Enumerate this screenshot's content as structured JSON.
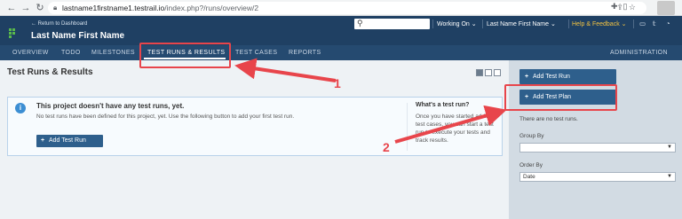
{
  "browser": {
    "url_domain": "lastname1firstname1.testrail.io",
    "url_path": "/index.php?/runs/overview/2",
    "icons": [
      "back-icon",
      "forward-icon",
      "reload-icon",
      "lock-icon",
      "share-icon",
      "star-icon",
      "extensions-icon",
      "sidebar-icon"
    ]
  },
  "header": {
    "return_link": "← Return to Dashboard",
    "project_title": "Last Name First Name",
    "working_on": "Working On",
    "user_name": "Last Name First Name",
    "help": "Help & Feedback"
  },
  "nav": {
    "tabs": [
      "OVERVIEW",
      "TODO",
      "MILESTONES",
      "TEST RUNS & RESULTS",
      "TEST CASES",
      "REPORTS"
    ],
    "admin": "ADMINISTRATION"
  },
  "main": {
    "title": "Test Runs & Results",
    "info_title": "This project doesn't have any test runs, yet.",
    "info_desc": "No test runs have been defined for this project, yet. Use the following button to add your first test run.",
    "add_button": "Add Test Run",
    "whatis_title": "What's a test run?",
    "whatis_desc": "Once you have started adding test cases, you can start a test run to execute your tests and track results."
  },
  "sidebar": {
    "add_test_run": "Add Test Run",
    "add_test_plan": "Add Test Plan",
    "no_runs": "There are no test runs.",
    "group_by_label": "Group By",
    "group_by_value": "",
    "order_by_label": "Order By",
    "order_by_value": "Date"
  },
  "annotations": {
    "num1": "1",
    "num2": "2"
  },
  "colors": {
    "header_bg": "#1f4063",
    "nav_bg": "#254a70",
    "button_bg": "#2e5f8c",
    "annotation_red": "#e8454b",
    "help_yellow": "#f3c342"
  }
}
